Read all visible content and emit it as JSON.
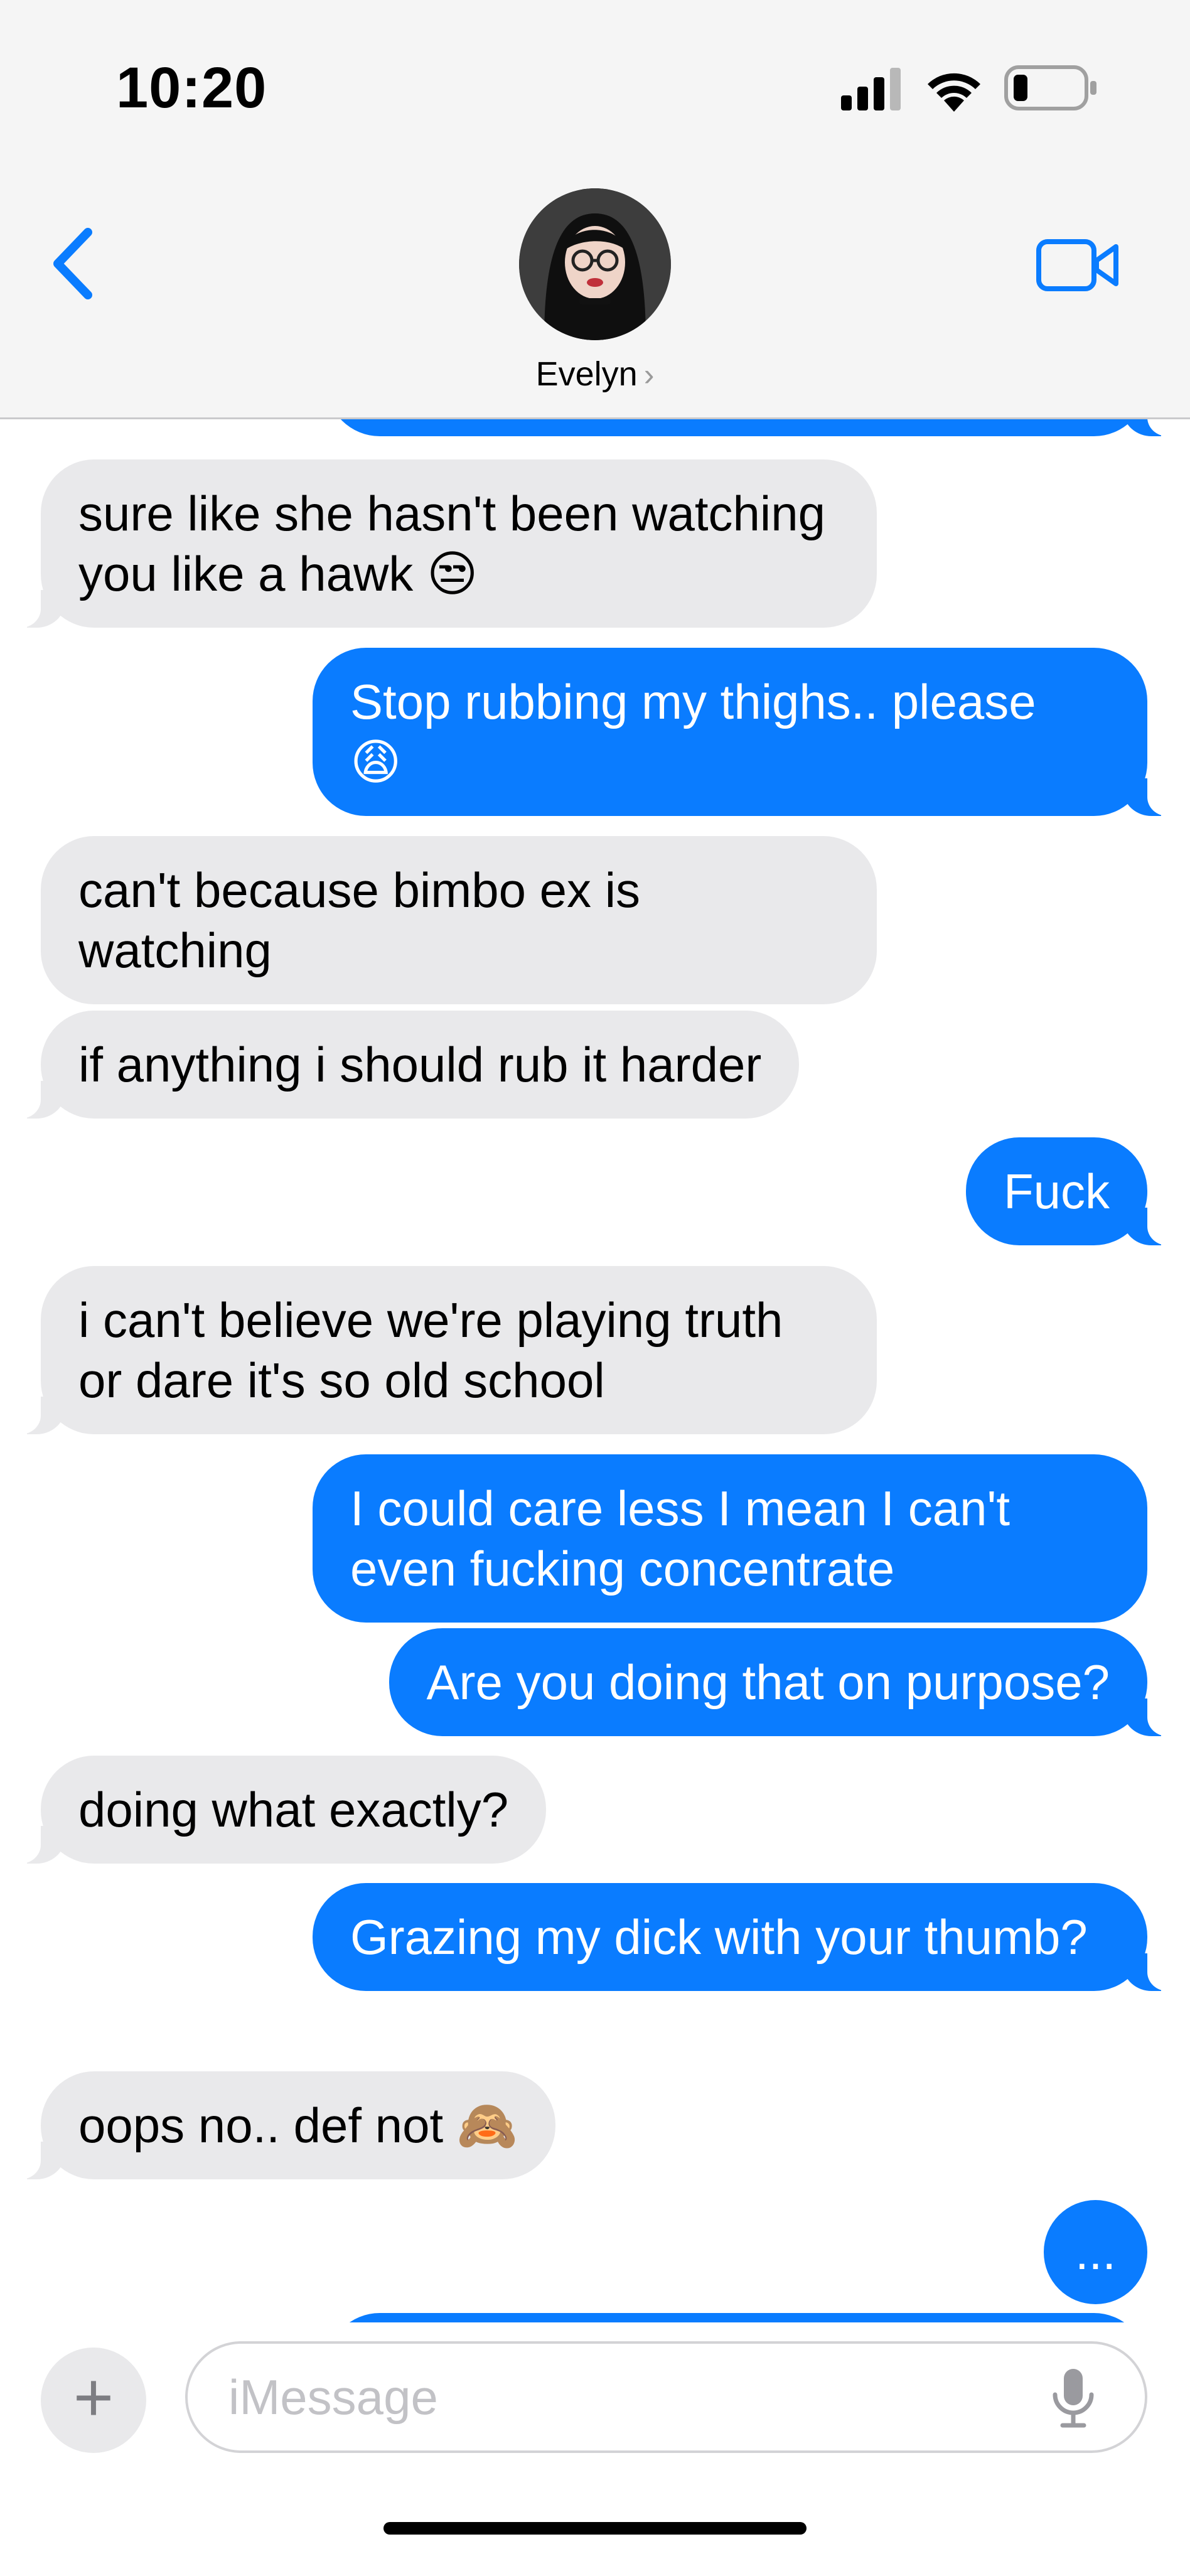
{
  "status_bar": {
    "time": "10:20",
    "signal_icon": "cellular-signal-icon",
    "wifi_icon": "wifi-icon",
    "battery_icon": "battery-icon",
    "battery_level": 0.2
  },
  "header": {
    "back_icon": "chevron-left-icon",
    "contact_name": "Evelyn",
    "contact_chevron": "›",
    "video_icon": "video-camera-icon"
  },
  "messages": [
    {
      "from": "them",
      "text": "sure like she hasn't been watching you like a hawk",
      "emoji": "😒"
    },
    {
      "from": "me",
      "text": "Stop rubbing my thighs.. please",
      "emoji": "😩"
    },
    {
      "from": "them",
      "text": "can't because bimbo ex is watching"
    },
    {
      "from": "them",
      "text": "if anything i should rub it harder"
    },
    {
      "from": "me",
      "text": "Fuck"
    },
    {
      "from": "them",
      "text": "i can't believe we're playing truth or dare it's so old school"
    },
    {
      "from": "me",
      "text": "I could care less I mean I can't even fucking concentrate"
    },
    {
      "from": "me",
      "text": "Are you doing that on purpose?"
    },
    {
      "from": "them",
      "text": "doing what exactly?"
    },
    {
      "from": "me",
      "text": "Grazing my dick with your thumb?"
    },
    {
      "from": "them",
      "text": "oops no.. def not",
      "emoji": "🙈"
    },
    {
      "from": "me",
      "text": "..."
    }
  ],
  "input_bar": {
    "plus_label": "+",
    "placeholder": "iMessage",
    "mic_icon": "microphone-icon"
  },
  "colors": {
    "outgoing_bubble": "#0a7cff",
    "incoming_bubble": "#e9e9eb",
    "accent": "#0a7cff"
  }
}
